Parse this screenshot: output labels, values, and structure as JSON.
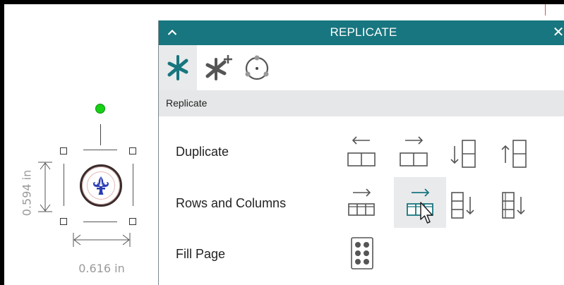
{
  "canvas": {
    "width_label": "0.616 in",
    "height_label": "0.594 in",
    "rotate_handle_color": "#16d116"
  },
  "panel": {
    "title": "REPLICATE",
    "header_color": "#17767f",
    "modes": [
      {
        "icon": "replicate-star-icon",
        "active": true
      },
      {
        "icon": "replicate-star-plus-icon",
        "active": false
      },
      {
        "icon": "rotate-circle-icon",
        "active": false
      }
    ],
    "section_label": "Replicate",
    "rows": [
      {
        "label": "Duplicate",
        "buttons": [
          "duplicate-left-icon",
          "duplicate-right-icon",
          "duplicate-down-icon",
          "duplicate-up-icon"
        ]
      },
      {
        "label": "Rows and Columns",
        "buttons": [
          "rows-left-icon",
          "rows-right-icon",
          "columns-down-icon",
          "columns-down-alt-icon"
        ]
      },
      {
        "label": "Fill Page",
        "buttons": [
          "fill-page-icon"
        ]
      }
    ],
    "hovered_button": "rows-right-icon"
  }
}
